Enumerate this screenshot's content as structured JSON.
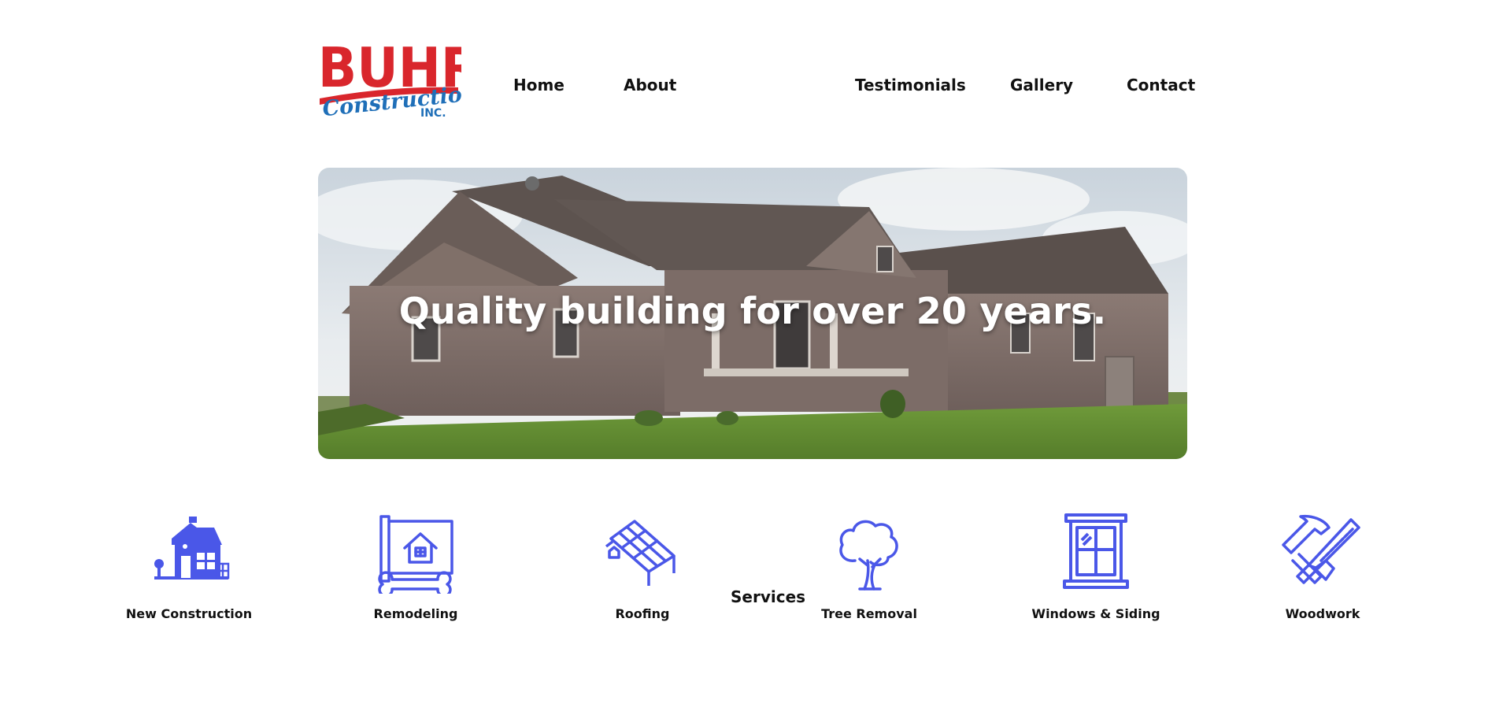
{
  "brand": {
    "logo_text_main": "BUHR",
    "logo_text_script": "Construction",
    "logo_text_suffix": "INC.",
    "logo_red": "#d9262c",
    "logo_blue": "#1f6fb8"
  },
  "nav": {
    "items": [
      {
        "label": "Home"
      },
      {
        "label": "About"
      },
      {
        "label": "Services"
      },
      {
        "label": "Testimonials"
      },
      {
        "label": "Gallery"
      },
      {
        "label": "Contact"
      }
    ]
  },
  "hero": {
    "title": "Quality building for over 20 years."
  },
  "services": {
    "icon_color": "#4a57e8",
    "items": [
      {
        "label": "New Construction",
        "icon": "house-icon"
      },
      {
        "label": "Remodeling",
        "icon": "blueprint-wrench-icon"
      },
      {
        "label": "Roofing",
        "icon": "roof-solar-icon"
      },
      {
        "label": "Tree Removal",
        "icon": "tree-icon"
      },
      {
        "label": "Windows & Siding",
        "icon": "window-icon"
      },
      {
        "label": "Woodwork",
        "icon": "hammer-saw-icon"
      }
    ]
  }
}
